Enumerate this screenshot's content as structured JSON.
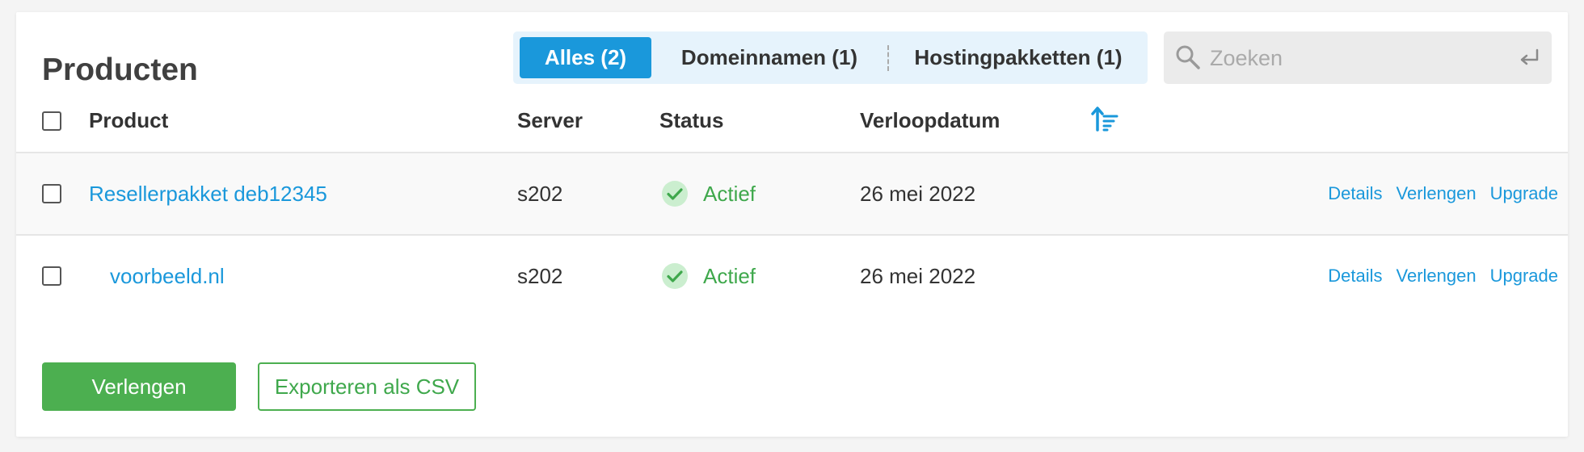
{
  "page": {
    "title": "Producten"
  },
  "tabs": [
    {
      "label": "Alles (2)",
      "active": true
    },
    {
      "label": "Domeinnamen (1)",
      "active": false
    },
    {
      "label": "Hostingpakketten (1)",
      "active": false
    }
  ],
  "search": {
    "placeholder": "Zoeken",
    "value": ""
  },
  "table": {
    "headers": {
      "product": "Product",
      "server": "Server",
      "status": "Status",
      "expiry": "Verloopdatum"
    },
    "rows": [
      {
        "product": "Resellerpakket deb12345",
        "server": "s202",
        "status": "Actief",
        "expiry": "26 mei 2022",
        "actions": [
          "Details",
          "Verlengen",
          "Upgrade"
        ]
      },
      {
        "product": "voorbeeld.nl",
        "server": "s202",
        "status": "Actief",
        "expiry": "26 mei 2022",
        "actions": [
          "Details",
          "Verlengen",
          "Upgrade"
        ]
      }
    ]
  },
  "buttons": {
    "renew": "Verlengen",
    "export": "Exporteren als CSV"
  },
  "colors": {
    "accent": "#1a98db",
    "success": "#4caf50",
    "status_text": "#3fa84c"
  }
}
